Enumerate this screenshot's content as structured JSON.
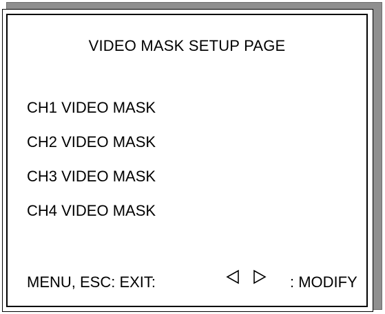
{
  "page": {
    "title": "VIDEO MASK SETUP PAGE"
  },
  "channels": [
    {
      "label": "CH1 VIDEO MASK"
    },
    {
      "label": "CH2 VIDEO MASK"
    },
    {
      "label": "CH3 VIDEO MASK"
    },
    {
      "label": "CH4 VIDEO MASK"
    }
  ],
  "footer": {
    "exit_label": "MENU, ESC: EXIT:",
    "left_icon": "triangle-left-icon",
    "right_icon": "triangle-right-icon",
    "modify_label": ": MODIFY"
  }
}
